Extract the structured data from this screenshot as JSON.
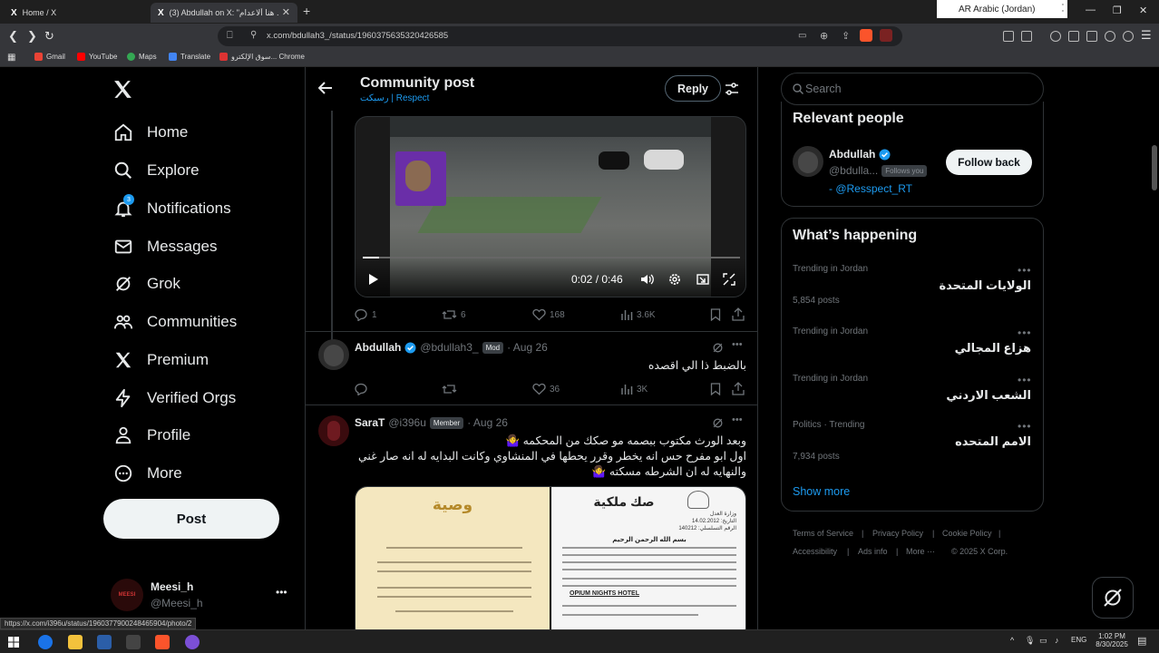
{
  "browser": {
    "tabs": [
      {
        "title": "Home / X",
        "active": false
      },
      {
        "title": "(3) Abdullah on X: \"هنا ألاعدام ...",
        "active": true
      }
    ],
    "url": "x.com/bdullah3_/status/1960375635320426585",
    "language_popup": "AR Arabic (Jordan)",
    "bookmarks": [
      "Gmail",
      "YouTube",
      "Maps",
      "Translate",
      "سوق الإلكترو... Chrome"
    ],
    "status_url": "https://x.com/i396u/status/1960377900248465904/photo/2"
  },
  "sidebar": {
    "logo": "X",
    "items": [
      {
        "label": "Home",
        "icon": "home-icon"
      },
      {
        "label": "Explore",
        "icon": "search-icon"
      },
      {
        "label": "Notifications",
        "icon": "bell-icon"
      },
      {
        "label": "Messages",
        "icon": "mail-icon"
      },
      {
        "label": "Grok",
        "icon": "grok-icon"
      },
      {
        "label": "Communities",
        "icon": "communities-icon"
      },
      {
        "label": "Premium",
        "icon": "x-premium-icon"
      },
      {
        "label": "Verified Orgs",
        "icon": "lightning-icon"
      },
      {
        "label": "Profile",
        "icon": "person-icon"
      },
      {
        "label": "More",
        "icon": "more-circle-icon"
      }
    ],
    "notification_count": "3",
    "post_label": "Post",
    "account": {
      "name": "Meesi_h",
      "handle": "@Meesi_h",
      "avatar_text": "MEESI"
    }
  },
  "header": {
    "title": "Community post",
    "subtitle": "رسبكت | Respect",
    "reply_label": "Reply"
  },
  "video": {
    "time": "0:02 / 0:46"
  },
  "main_post_metrics": {
    "replies": "1",
    "reposts": "6",
    "likes": "168",
    "views": "3.6K"
  },
  "reply1": {
    "name": "Abdullah",
    "handle": "@bdullah3_",
    "badge": "Mod",
    "date": "· Aug 26",
    "text": "بالضبط ذا الي اقصده",
    "metrics": {
      "replies": "",
      "reposts": "",
      "likes": "36",
      "views": "3K"
    }
  },
  "reply2": {
    "name": "SaraT",
    "handle": "@i396u",
    "badge": "Member",
    "date": "· Aug 26",
    "lines": [
      "وبعد الورث مكتوب ببصمه مو صكك من المحكمه 🤷‍♀️",
      "اول ابو مفرح حس انه يخطر وقرر يحطها في المنشاوي وكانت البدايه له انه صار غني",
      "والنهايه له ان الشرطه مسكته 🤷‍♀️"
    ],
    "image_left_title": "وصية",
    "image_right_title": "صك ملكية",
    "image_right_lines": [
      "وزارة العدل",
      "التاريخ: 14.02.2012",
      "الرقم التسلسلي: 140212",
      "بسم الله الرحمن الرحيم",
      "OPIUM NIGHTS HOTEL"
    ]
  },
  "right": {
    "search_placeholder": "Search",
    "relevant_title": "Relevant people",
    "person": {
      "name": "Abdullah",
      "handle": "@bdulla...",
      "follows_you": "Follows you",
      "bio": "- @Resspect_RT",
      "follow_label": "Follow back"
    },
    "happening_title": "What’s happening",
    "trends": [
      {
        "meta": "Trending in Jordan",
        "title": "الولايات المتحدة",
        "posts": "5,854 posts"
      },
      {
        "meta": "Trending in Jordan",
        "title": "هزاع المجالي",
        "posts": ""
      },
      {
        "meta": "Trending in Jordan",
        "title": "الشعب الاردني",
        "posts": ""
      },
      {
        "meta": "Politics · Trending",
        "title": "الامم المتحده",
        "posts": "7,934 posts"
      }
    ],
    "show_more": "Show more",
    "footer_line1": [
      "Terms of Service",
      "Privacy Policy",
      "Cookie Policy"
    ],
    "footer_line2": [
      "Accessibility",
      "Ads info",
      "More ···",
      "© 2025 X Corp."
    ]
  },
  "taskbar": {
    "time": "1:02 PM",
    "date": "8/30/2025",
    "lang": "ENG"
  },
  "colors": {
    "accent": "#1d9bf0",
    "text": "#e7e9ea",
    "muted": "#71767b",
    "border": "#2f3336"
  }
}
